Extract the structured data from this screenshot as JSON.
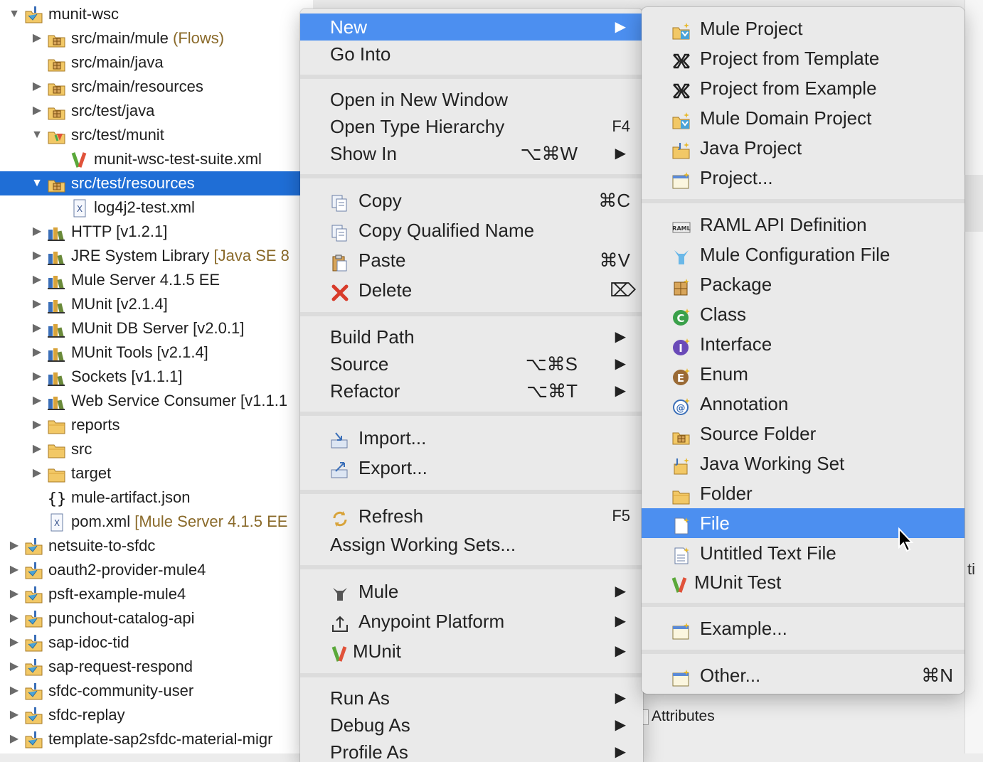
{
  "tree": {
    "rows": [
      {
        "label": "munit-wsc",
        "decoration": "",
        "twisty": "down",
        "level": 0,
        "icon": "project-icon"
      },
      {
        "label": "src/main/mule",
        "decoration": " (Flows)",
        "twisty": "right",
        "level": 1,
        "icon": "source-folder-icon"
      },
      {
        "label": "src/main/java",
        "decoration": "",
        "twisty": "",
        "level": 1,
        "icon": "source-folder-icon"
      },
      {
        "label": "src/main/resources",
        "decoration": "",
        "twisty": "right",
        "level": 1,
        "icon": "source-folder-icon"
      },
      {
        "label": "src/test/java",
        "decoration": "",
        "twisty": "right",
        "level": 1,
        "icon": "source-folder-icon"
      },
      {
        "label": "src/test/munit",
        "decoration": "",
        "twisty": "down",
        "level": 1,
        "icon": "munit-folder-icon"
      },
      {
        "label": "munit-wsc-test-suite.xml",
        "decoration": "",
        "twisty": "",
        "level": 2,
        "icon": "munit-icon"
      },
      {
        "label": "src/test/resources",
        "decoration": "",
        "twisty": "down",
        "level": 1,
        "icon": "source-folder-icon",
        "selected": true
      },
      {
        "label": "log4j2-test.xml",
        "decoration": "",
        "twisty": "",
        "level": 2,
        "icon": "xml-file-icon"
      },
      {
        "label": "HTTP [v1.2.1]",
        "decoration": "",
        "twisty": "right",
        "level": 1,
        "icon": "library-icon"
      },
      {
        "label": "JRE System Library",
        "decoration": " [Java SE 8",
        "twisty": "right",
        "level": 1,
        "icon": "library-icon"
      },
      {
        "label": "Mule Server 4.1.5 EE",
        "decoration": "",
        "twisty": "right",
        "level": 1,
        "icon": "library-icon"
      },
      {
        "label": "MUnit [v2.1.4]",
        "decoration": "",
        "twisty": "right",
        "level": 1,
        "icon": "library-icon"
      },
      {
        "label": "MUnit DB Server [v2.0.1]",
        "decoration": "",
        "twisty": "right",
        "level": 1,
        "icon": "library-icon"
      },
      {
        "label": "MUnit Tools [v2.1.4]",
        "decoration": "",
        "twisty": "right",
        "level": 1,
        "icon": "library-icon"
      },
      {
        "label": "Sockets [v1.1.1]",
        "decoration": "",
        "twisty": "right",
        "level": 1,
        "icon": "library-icon"
      },
      {
        "label": "Web Service Consumer [v1.1.1",
        "decoration": "",
        "twisty": "right",
        "level": 1,
        "icon": "library-icon"
      },
      {
        "label": "reports",
        "decoration": "",
        "twisty": "right",
        "level": 1,
        "icon": "folder-icon"
      },
      {
        "label": "src",
        "decoration": "",
        "twisty": "right",
        "level": 1,
        "icon": "folder-icon"
      },
      {
        "label": "target",
        "decoration": "",
        "twisty": "right",
        "level": 1,
        "icon": "folder-icon"
      },
      {
        "label": "mule-artifact.json",
        "decoration": "",
        "twisty": "",
        "level": 1,
        "icon": "json-file-icon"
      },
      {
        "label": "pom.xml",
        "decoration": " [Mule Server 4.1.5 EE",
        "twisty": "",
        "level": 1,
        "icon": "xml-file-icon"
      },
      {
        "label": "netsuite-to-sfdc",
        "decoration": "",
        "twisty": "right",
        "level": 0,
        "icon": "project-icon"
      },
      {
        "label": "oauth2-provider-mule4",
        "decoration": "",
        "twisty": "right",
        "level": 0,
        "icon": "project-icon"
      },
      {
        "label": "psft-example-mule4",
        "decoration": "",
        "twisty": "right",
        "level": 0,
        "icon": "project-icon"
      },
      {
        "label": "punchout-catalog-api",
        "decoration": "",
        "twisty": "right",
        "level": 0,
        "icon": "project-icon"
      },
      {
        "label": "sap-idoc-tid",
        "decoration": "",
        "twisty": "right",
        "level": 0,
        "icon": "project-icon"
      },
      {
        "label": "sap-request-respond",
        "decoration": "",
        "twisty": "right",
        "level": 0,
        "icon": "project-icon"
      },
      {
        "label": "sfdc-community-user",
        "decoration": "",
        "twisty": "right",
        "level": 0,
        "icon": "project-icon"
      },
      {
        "label": "sfdc-replay",
        "decoration": "",
        "twisty": "right",
        "level": 0,
        "icon": "project-icon"
      },
      {
        "label": "template-sap2sfdc-material-migr",
        "decoration": "",
        "twisty": "right",
        "level": 0,
        "icon": "project-icon"
      }
    ]
  },
  "context_menu": {
    "items": [
      {
        "label": "New",
        "shortcut": "",
        "submenu": true,
        "highlighted": true,
        "icon": ""
      },
      {
        "label": "Go Into",
        "shortcut": "",
        "submenu": false,
        "icon": ""
      },
      {
        "separator": true
      },
      {
        "label": "Open in New Window",
        "shortcut": "",
        "submenu": false,
        "icon": ""
      },
      {
        "label": "Open Type Hierarchy",
        "shortcut": "F4",
        "submenu": false,
        "icon": ""
      },
      {
        "label": "Show In",
        "shortcut": "⌥⌘W",
        "submenu": true,
        "icon": ""
      },
      {
        "separator": true
      },
      {
        "label": "Copy",
        "shortcut": "⌘C",
        "submenu": false,
        "icon": "copy-icon"
      },
      {
        "label": "Copy Qualified Name",
        "shortcut": "",
        "submenu": false,
        "icon": "copy-qualified-icon"
      },
      {
        "label": "Paste",
        "shortcut": "⌘V",
        "submenu": false,
        "icon": "paste-icon"
      },
      {
        "label": "Delete",
        "shortcut": "⌦",
        "submenu": false,
        "icon": "delete-icon"
      },
      {
        "separator": true
      },
      {
        "label": "Build Path",
        "shortcut": "",
        "submenu": true,
        "icon": ""
      },
      {
        "label": "Source",
        "shortcut": "⌥⌘S",
        "submenu": true,
        "icon": ""
      },
      {
        "label": "Refactor",
        "shortcut": "⌥⌘T",
        "submenu": true,
        "icon": ""
      },
      {
        "separator": true
      },
      {
        "label": "Import...",
        "shortcut": "",
        "submenu": false,
        "icon": "import-icon"
      },
      {
        "label": "Export...",
        "shortcut": "",
        "submenu": false,
        "icon": "export-icon"
      },
      {
        "separator": true
      },
      {
        "label": "Refresh",
        "shortcut": "F5",
        "submenu": false,
        "icon": "refresh-icon"
      },
      {
        "label": "Assign Working Sets...",
        "shortcut": "",
        "submenu": false,
        "icon": ""
      },
      {
        "separator": true
      },
      {
        "label": "Mule",
        "shortcut": "",
        "submenu": true,
        "icon": "mule-icon"
      },
      {
        "label": "Anypoint Platform",
        "shortcut": "",
        "submenu": true,
        "icon": "anypoint-icon"
      },
      {
        "label": "MUnit",
        "shortcut": "",
        "submenu": true,
        "icon": "munit-icon"
      },
      {
        "separator": true
      },
      {
        "label": "Run As",
        "shortcut": "",
        "submenu": true,
        "icon": ""
      },
      {
        "label": "Debug As",
        "shortcut": "",
        "submenu": true,
        "icon": ""
      },
      {
        "label": "Profile As",
        "shortcut": "",
        "submenu": true,
        "icon": ""
      }
    ]
  },
  "new_submenu": {
    "items": [
      {
        "label": "Mule Project",
        "icon": "mule-project-icon"
      },
      {
        "label": "Project from Template",
        "icon": "template-icon"
      },
      {
        "label": "Project from Example",
        "icon": "example-icon"
      },
      {
        "label": "Mule Domain Project",
        "icon": "mule-domain-project-icon"
      },
      {
        "label": "Java Project",
        "icon": "java-project-icon"
      },
      {
        "label": "Project...",
        "icon": "new-project-icon"
      },
      {
        "separator": true
      },
      {
        "label": "RAML API Definition",
        "icon": "raml-icon"
      },
      {
        "label": "Mule Configuration File",
        "icon": "mule-config-icon"
      },
      {
        "label": "Package",
        "icon": "package-icon"
      },
      {
        "label": "Class",
        "icon": "class-icon"
      },
      {
        "label": "Interface",
        "icon": "interface-icon"
      },
      {
        "label": "Enum",
        "icon": "enum-icon"
      },
      {
        "label": "Annotation",
        "icon": "annotation-icon"
      },
      {
        "label": "Source Folder",
        "icon": "source-folder-icon"
      },
      {
        "label": "Java Working Set",
        "icon": "working-set-icon"
      },
      {
        "label": "Folder",
        "icon": "folder-icon"
      },
      {
        "label": "File",
        "icon": "file-icon",
        "highlighted": true
      },
      {
        "label": "Untitled Text File",
        "icon": "text-file-icon"
      },
      {
        "label": "MUnit Test",
        "icon": "munit-icon"
      },
      {
        "separator": true
      },
      {
        "label": "Example...",
        "icon": "example-wizard-icon"
      },
      {
        "separator": true
      },
      {
        "label": "Other...",
        "shortcut": "⌘N",
        "icon": "other-wizard-icon"
      }
    ]
  },
  "background": {
    "attributes_label": "Attributes",
    "partial_text": "ti"
  },
  "colors": {
    "selection": "#1f6ed6",
    "menu_highlight": "#4c8ff0",
    "menu_bg": "#eaeaea",
    "decoration_text": "#8a6a2a"
  }
}
